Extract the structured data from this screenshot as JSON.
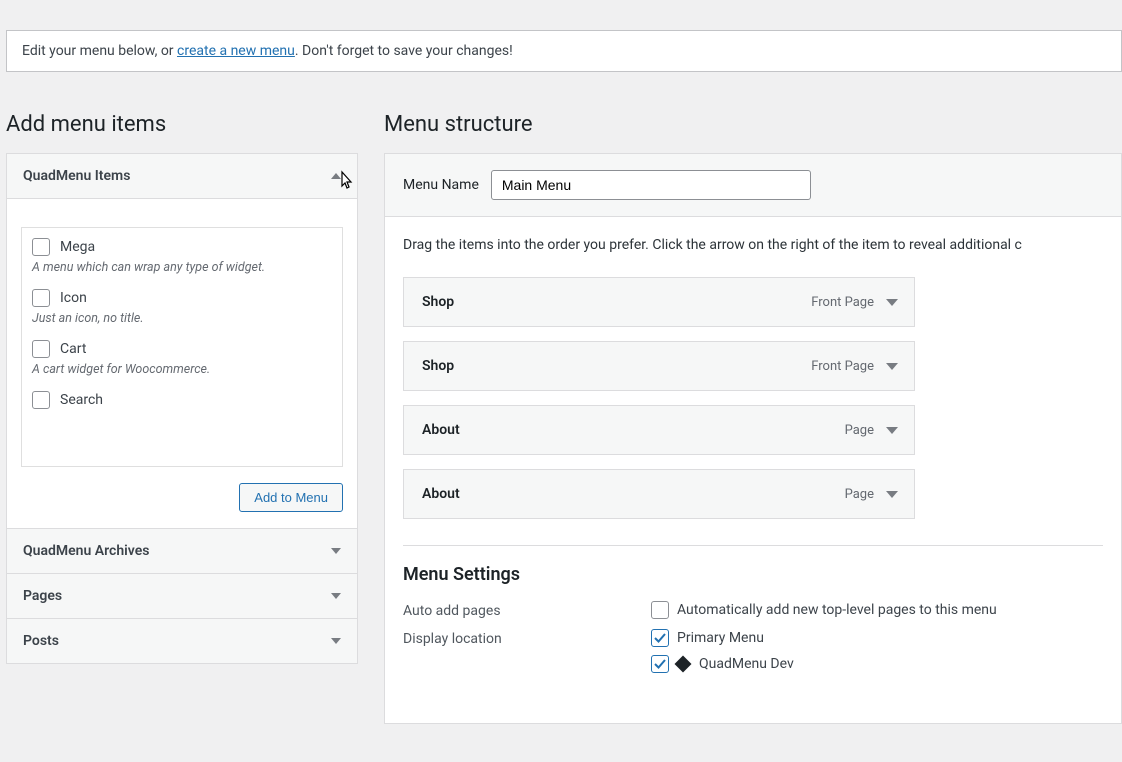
{
  "notice": {
    "prefix": "Edit your menu below, or ",
    "link": "create a new menu",
    "suffix": ". Don't forget to save your changes!"
  },
  "left": {
    "heading": "Add menu items",
    "quadmenu_items": {
      "title": "QuadMenu Items",
      "items": [
        {
          "label": "Mega",
          "desc": "A menu which can wrap any type of widget."
        },
        {
          "label": "Icon",
          "desc": "Just an icon, no title."
        },
        {
          "label": "Cart",
          "desc": "A cart widget for Woocommerce."
        },
        {
          "label": "Search",
          "desc": ""
        }
      ],
      "add_button": "Add to Menu"
    },
    "panels": [
      {
        "title": "QuadMenu Archives"
      },
      {
        "title": "Pages"
      },
      {
        "title": "Posts"
      }
    ]
  },
  "right": {
    "heading": "Menu structure",
    "menu_name_label": "Menu Name",
    "menu_name_value": "Main Menu",
    "hint": "Drag the items into the order you prefer. Click the arrow on the right of the item to reveal additional c",
    "items": [
      {
        "label": "Shop",
        "type": "Front Page"
      },
      {
        "label": "Shop",
        "type": "Front Page"
      },
      {
        "label": "About",
        "type": "Page"
      },
      {
        "label": "About",
        "type": "Page"
      }
    ],
    "settings": {
      "title": "Menu Settings",
      "auto_add_label": "Auto add pages",
      "auto_add_option": "Automatically add new top-level pages to this menu",
      "display_loc_label": "Display location",
      "loc_primary": "Primary Menu",
      "loc_quad": "QuadMenu Dev"
    }
  }
}
